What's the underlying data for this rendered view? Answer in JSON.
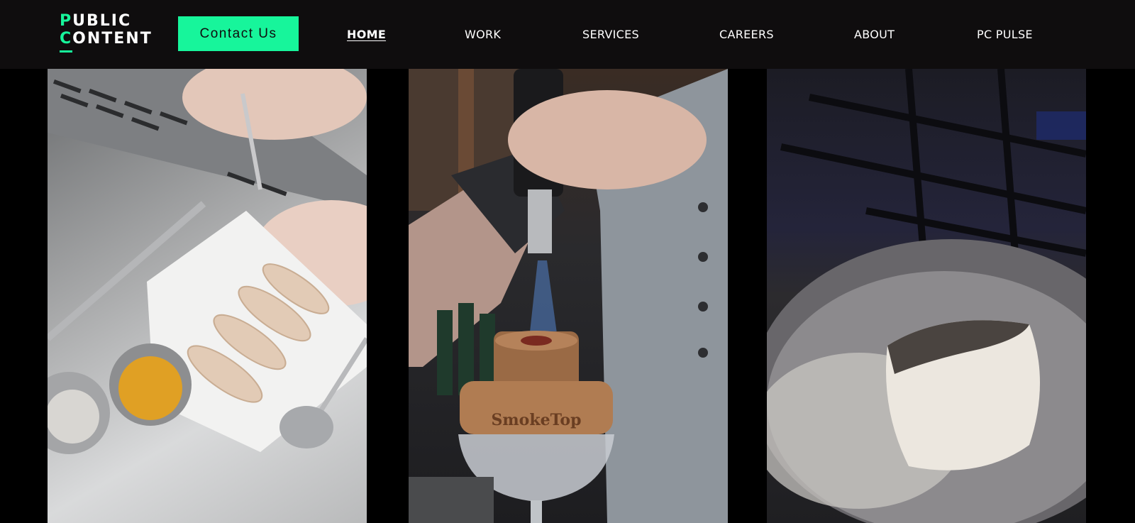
{
  "header": {
    "logo": {
      "line1_accent": "P",
      "line1_rest": "UBLIC",
      "line2_accent": "C",
      "line2_rest": "ONTENT"
    },
    "contact_label": "Contact Us",
    "nav": {
      "home": "HOME",
      "work": "WORK",
      "services": "SERVICES",
      "careers": "CAREERS",
      "about": "ABOUT",
      "pc_pulse": "PC PULSE"
    }
  },
  "panels": {
    "smoke_top_label": "SmokeTop"
  },
  "colors": {
    "accent": "#17f59b",
    "header_bg": "#0f0d0e",
    "page_bg": "#000000"
  }
}
